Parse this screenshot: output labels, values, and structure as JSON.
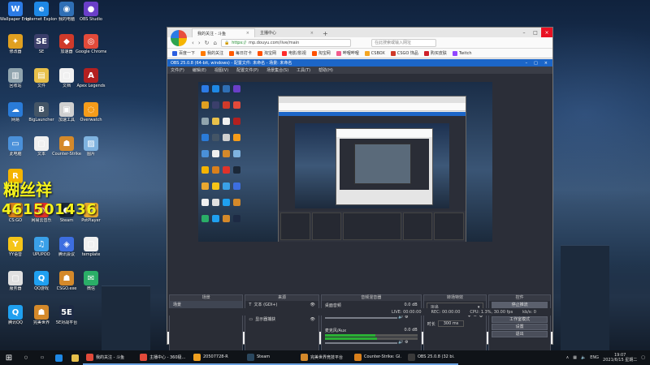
{
  "desktop": {
    "icons": [
      {
        "label": "Wallpaper Engine",
        "color": "#2c7be5",
        "glyph": "W"
      },
      {
        "label": "Internet Explorer",
        "color": "#1e88e5",
        "glyph": "e"
      },
      {
        "label": "我的电脑",
        "color": "#2f6fb5",
        "glyph": "◉"
      },
      {
        "label": "OBS Studio",
        "color": "#6a3fc8",
        "glyph": "●"
      },
      {
        "label": "修改器",
        "color": "#e0a020",
        "glyph": "✦"
      },
      {
        "label": "SE",
        "color": "#3b3f6b",
        "glyph": "SE"
      },
      {
        "label": "加速器",
        "color": "#cf3a2a",
        "glyph": "◆"
      },
      {
        "label": "Google Chrome",
        "color": "#e24a3a",
        "glyph": "◎"
      },
      {
        "label": "回收站",
        "color": "#90a4ae",
        "glyph": "▥"
      },
      {
        "label": "文件",
        "color": "#e8c04a",
        "glyph": "▤"
      },
      {
        "label": "文档",
        "color": "#f0f0f0",
        "glyph": "▢"
      },
      {
        "label": "Apex Legends",
        "color": "#b32020",
        "glyph": "A"
      },
      {
        "label": "网易",
        "color": "#2a7bd8",
        "glyph": "☁"
      },
      {
        "label": "BigLauncher",
        "color": "#445566",
        "glyph": "B"
      },
      {
        "label": "加速工具",
        "color": "#d0d0d0",
        "glyph": "▣"
      },
      {
        "label": "Overwatch",
        "color": "#f59c1a",
        "glyph": "◌"
      },
      {
        "label": "此电脑",
        "color": "#4a90d9",
        "glyph": "▭"
      },
      {
        "label": "文本",
        "color": "#f0f0f0",
        "glyph": "▢"
      },
      {
        "label": "Counter-Strike",
        "color": "#d4892a",
        "glyph": "☗"
      },
      {
        "label": "图片",
        "color": "#7fb3e0",
        "glyph": "▨"
      },
      {
        "label": "Rockstar",
        "color": "#f5b400",
        "glyph": "R"
      },
      {
        "label": "CS:GO",
        "color": "#d9801c",
        "glyph": "☗"
      },
      {
        "label": "网易云音乐",
        "color": "#e0322a",
        "glyph": "◍"
      },
      {
        "label": "Steam",
        "color": "#1b2838",
        "glyph": "◐"
      },
      {
        "label": "PotPlayer",
        "color": "#e8a830",
        "glyph": "▶"
      },
      {
        "label": "YY语音",
        "color": "#f5c518",
        "glyph": "Y"
      },
      {
        "label": "UPUPOO",
        "color": "#3aa0e8",
        "glyph": "♫"
      },
      {
        "label": "腾讯会议",
        "color": "#3d6ee0",
        "glyph": "◈"
      },
      {
        "label": "template",
        "color": "#f0f0f0",
        "glyph": "▢"
      },
      {
        "label": "服务器",
        "color": "#e0e0e0",
        "glyph": "▢"
      },
      {
        "label": "QQ游戏",
        "color": "#1fa0f0",
        "glyph": "Q"
      },
      {
        "label": "CSGO.exe",
        "color": "#d4892a",
        "glyph": "☗"
      },
      {
        "label": "微信",
        "color": "#2aae67",
        "glyph": "✉"
      },
      {
        "label": "腾讯QQ",
        "color": "#1fa0f0",
        "glyph": "Q"
      },
      {
        "label": "完美世界",
        "color": "#d4892a",
        "glyph": "☗"
      },
      {
        "label": "5E对战平台",
        "color": "#1d2a44",
        "glyph": "5E"
      }
    ],
    "overlay_name": "糊丝祥",
    "overlay_number": "461501436"
  },
  "browser": {
    "tabs": [
      {
        "label": "我的关注 - 斗鱼",
        "active": true
      },
      {
        "label": "主播中心",
        "active": false
      }
    ],
    "url_prefix": "https://",
    "url": "mp.douyu.com/live/main",
    "search_placeholder": "在此搜索或输入网址",
    "bookmarks": [
      {
        "label": "百度一下",
        "color": "#2b5ee0"
      },
      {
        "label": "我的关注",
        "color": "#ff7a00"
      },
      {
        "label": "每日打卡",
        "color": "#ff5a00"
      },
      {
        "label": "淘宝网",
        "color": "#ff5000"
      },
      {
        "label": "电影/影视",
        "color": "#ff2b2b"
      },
      {
        "label": "淘宝网",
        "color": "#ff5000"
      },
      {
        "label": "哔哩哔哩",
        "color": "#f25d8e"
      },
      {
        "label": "CSBOX",
        "color": "#f5a623"
      },
      {
        "label": "CSGO 饰品",
        "color": "#cf3a2a"
      },
      {
        "label": "购买皮肤",
        "color": "#d0202a"
      },
      {
        "label": "Twitch",
        "color": "#9146ff"
      }
    ]
  },
  "obs": {
    "title": "OBS 25.0.8 (64-bit, windows) - 配置文件: 未命名 - 场景: 未命名",
    "menu": [
      "文件(F)",
      "编辑(E)",
      "视图(V)",
      "配置文件(P)",
      "场景集合(S)",
      "工具(T)",
      "帮助(H)"
    ],
    "docks": {
      "scenes_title": "场景",
      "scenes": [
        "场景"
      ],
      "sources_title": "来源",
      "sources": [
        "文本 (GDI+)",
        "图像",
        "显示器捕获"
      ],
      "mixer_title": "音频混音器",
      "mixer": [
        {
          "name": "桌面音频",
          "level": "0.0 dB"
        },
        {
          "name": "麦克风/Aux",
          "level": "0.0 dB"
        }
      ],
      "transitions_title": "转场特效",
      "transition_type": "淡出",
      "duration_label": "时长",
      "duration_value": "300 ms",
      "controls_title": "控件",
      "controls": [
        "停止推流",
        "开始录制",
        "工作室模式",
        "设置",
        "退出"
      ]
    },
    "status": {
      "live": "LIVE: 00:00:00",
      "rec": "REC: 00:00:00",
      "cpu": "CPU: 1.3%, 30.00 fps",
      "kbps": "kb/s: 0"
    }
  },
  "taskbar": {
    "items": [
      {
        "label": "我的关注 - 斗鱼",
        "color": "#e24a3a"
      },
      {
        "label": "主播中心 - 360极…",
        "color": "#e24a3a"
      },
      {
        "label": "20507728-R",
        "color": "#f0a020"
      },
      {
        "label": "Steam",
        "color": "#2a475e"
      },
      {
        "label": "完美世界竞技平台",
        "color": "#d4892a"
      },
      {
        "label": "Counter-Strike: Gl…",
        "color": "#d9801c"
      },
      {
        "label": "OBS 25.0.8 (32 bi…",
        "color": "#3a3a3a"
      }
    ],
    "lang": "ENG",
    "time": "19:07",
    "date": "2021/6/15 星期二"
  }
}
